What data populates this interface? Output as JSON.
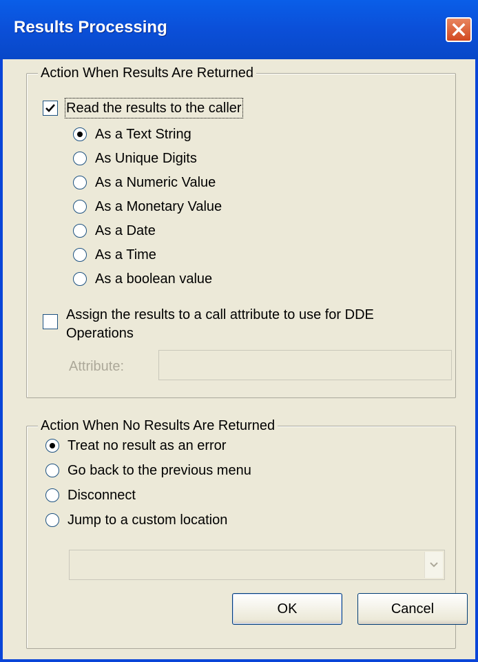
{
  "window": {
    "title": "Results Processing"
  },
  "group_returned": {
    "legend": "Action When Results Are Returned",
    "read_results": {
      "label": "Read the results to the caller",
      "checked": true
    },
    "format_options": [
      {
        "label": "As a Text String",
        "selected": true
      },
      {
        "label": "As Unique Digits",
        "selected": false
      },
      {
        "label": "As a Numeric Value",
        "selected": false
      },
      {
        "label": "As a Monetary Value",
        "selected": false
      },
      {
        "label": "As a Date",
        "selected": false
      },
      {
        "label": "As a Time",
        "selected": false
      },
      {
        "label": "As a boolean value",
        "selected": false
      }
    ],
    "assign_results": {
      "label_line1": "Assign the results to a call attribute to use for DDE",
      "label_line2": "Operations",
      "checked": false
    },
    "attribute": {
      "label": "Attribute:",
      "value": ""
    }
  },
  "group_no_results": {
    "legend": "Action When No Results Are Returned",
    "options": [
      {
        "label": "Treat no result as an error",
        "selected": true
      },
      {
        "label": "Go back to the previous menu",
        "selected": false
      },
      {
        "label": "Disconnect",
        "selected": false
      },
      {
        "label": "Jump to a custom location",
        "selected": false
      }
    ],
    "custom_location": {
      "value": ""
    }
  },
  "buttons": {
    "ok": "OK",
    "cancel": "Cancel"
  },
  "colors": {
    "title_bar": "#0b4fd8",
    "face": "#ece9d8",
    "close": "#d24820"
  }
}
